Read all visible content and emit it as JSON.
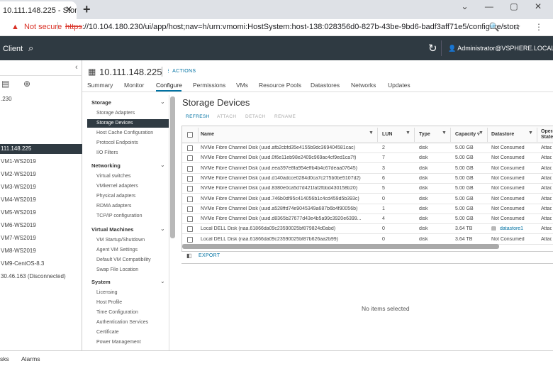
{
  "browser": {
    "tab_title": "10.111.148.225 - Stora",
    "tab_close": "✕",
    "new_tab": "+",
    "window_controls": "⌄ — ▢ ✕",
    "security_label": "Not secure",
    "url_scheme": "https",
    "url_rest": "://10.104.180.230/ui/app/host;nav=h/urn:vmomi:HostSystem:host-138:028356d0-827b-43be-9bd6-badf3aff71e5/configure/storage-de...",
    "addr_icons": "🔍 ☆ ⋮"
  },
  "header": {
    "client_label": "Client",
    "user": "Administrator@VSPHERE.LOCAL ⌄"
  },
  "left_nav": {
    "items": [
      {
        "label": ".230"
      },
      {
        "label": "111.148.225",
        "selected": true
      },
      {
        "label": "VM1-WS2019"
      },
      {
        "label": "VM2-WS2019"
      },
      {
        "label": "VM3-WS2019"
      },
      {
        "label": "VM4-WS2019"
      },
      {
        "label": "VM5-WS2019"
      },
      {
        "label": "VM6-WS2019"
      },
      {
        "label": "VM7-WS2019"
      },
      {
        "label": "VM8-WS2019"
      },
      {
        "label": "VM9-CentOS-8.3"
      },
      {
        "label": "30.46.163 (Disconnected)"
      }
    ]
  },
  "host": {
    "name": "10.111.148.225",
    "actions_label": "⋮ ACTIONS"
  },
  "tabs": [
    "Summary",
    "Monitor",
    "Configure",
    "Permissions",
    "VMs",
    "Resource Pools",
    "Datastores",
    "Networks",
    "Updates"
  ],
  "config_menu": {
    "sections": [
      {
        "title": "Storage",
        "items": [
          "Storage Adapters",
          "Storage Devices",
          "Host Cache Configuration",
          "Protocol Endpoints",
          "I/O Filters"
        ]
      },
      {
        "title": "Networking",
        "items": [
          "Virtual switches",
          "VMkernel adapters",
          "Physical adapters",
          "RDMA adapters",
          "TCP/IP configuration"
        ]
      },
      {
        "title": "Virtual Machines",
        "items": [
          "VM Startup/Shutdown",
          "Agent VM Settings",
          "Default VM Compatibility",
          "Swap File Location"
        ]
      },
      {
        "title": "System",
        "items": [
          "Licensing",
          "Host Profile",
          "Time Configuration",
          "Authentication Services",
          "Certificate",
          "Power Management"
        ]
      }
    ],
    "selected": "Storage Devices"
  },
  "storage_devices": {
    "title": "Storage Devices",
    "buttons": [
      {
        "label": "REFRESH",
        "enabled": true
      },
      {
        "label": "ATTACH",
        "enabled": false
      },
      {
        "label": "DETACH",
        "enabled": false
      },
      {
        "label": "RENAME",
        "enabled": false
      }
    ],
    "columns": [
      "Name",
      "LUN",
      "Type",
      "Capacity ▿",
      "Datastore",
      "Opera State"
    ],
    "rows": [
      {
        "name": "NVMe Fibre Channel Disk (uuid.afb2cbfd35e4155b9dc369404581cac)",
        "lun": "2",
        "type": "disk",
        "capacity": "5.00 GB",
        "datastore": "Not Consumed",
        "state": "Attac"
      },
      {
        "name": "NVMe Fibre Channel Disk (uuid.0f6e11eb98e2409c969ac4cf9ed1ca7f)",
        "lun": "7",
        "type": "disk",
        "capacity": "5.00 GB",
        "datastore": "Not Consumed",
        "state": "Attac"
      },
      {
        "name": "NVMe Fibre Channel Disk (uuid.eea397e8fa954effb4b4c67deaa07645)",
        "lun": "3",
        "type": "disk",
        "capacity": "5.00 GB",
        "datastore": "Not Consumed",
        "state": "Attac"
      },
      {
        "name": "NVMe Fibre Channel Disk (uuid.d140adcce0284d0ca7c275b0be5107d2)",
        "lun": "6",
        "type": "disk",
        "capacity": "5.00 GB",
        "datastore": "Not Consumed",
        "state": "Attac"
      },
      {
        "name": "NVMe Fibre Channel Disk (uuid.8380e0ca5d7d421faf2fbbd430158b20)",
        "lun": "5",
        "type": "disk",
        "capacity": "5.00 GB",
        "datastore": "Not Consumed",
        "state": "Attac"
      },
      {
        "name": "NVMe Fibre Channel Disk (uuid.746b0df95c414056b1c4cd459d5b393c)",
        "lun": "0",
        "type": "disk",
        "capacity": "5.00 GB",
        "datastore": "Not Consumed",
        "state": "Attac"
      },
      {
        "name": "NVMe Fibre Channel Disk (uuid.a528ffd74e9045349a687b6b4f90056b)",
        "lun": "1",
        "type": "disk",
        "capacity": "5.00 GB",
        "datastore": "Not Consumed",
        "state": "Attac"
      },
      {
        "name": "NVMe Fibre Channel Disk (uuid.d8365b27677d43e4b5a99c3920e6399...",
        "lun": "4",
        "type": "disk",
        "capacity": "5.00 GB",
        "datastore": "Not Consumed",
        "state": "Attac"
      },
      {
        "name": "Local DELL Disk (naa.61866da09c23590025bf879824d0abd)",
        "lun": "0",
        "type": "disk",
        "capacity": "3.64 TB",
        "datastore": "datastore1",
        "datastore_link": true,
        "state": "Attac"
      },
      {
        "name": "Local DELL Disk (naa.61866da09c23590025bf87b626aa2b99)",
        "lun": "0",
        "type": "disk",
        "capacity": "3.64 TB",
        "datastore": "Not Consumed",
        "state": "Attac"
      }
    ],
    "export_label": "EXPORT",
    "empty_detail": "No items selected"
  },
  "bottom_bar": {
    "tasks_label": "sks",
    "alarms_label": "Alarms"
  },
  "colors": {
    "header_bg": "#2f3a42",
    "link": "#0072a3",
    "selected_bg": "#2f3a42",
    "danger": "#d93025"
  }
}
